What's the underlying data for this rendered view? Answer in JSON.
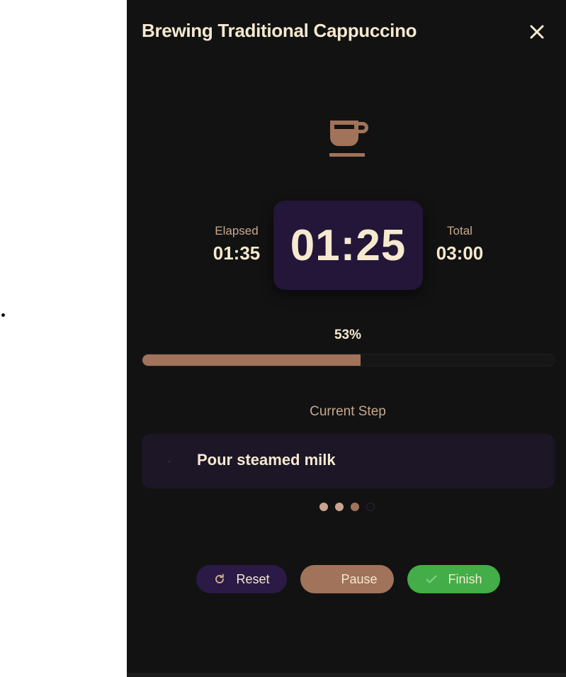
{
  "modal": {
    "title": "Brewing Traditional Cappuccino"
  },
  "icons": {
    "close": "close-icon",
    "cup": "coffee-cup-icon",
    "reset": "refresh-icon",
    "finish": "check-icon"
  },
  "stats": {
    "elapsed_label": "Elapsed",
    "elapsed_value": "01:35",
    "total_label": "Total",
    "total_value": "03:00"
  },
  "timer": {
    "remaining": "01:25"
  },
  "progress": {
    "label": "53%",
    "value": 0.53
  },
  "step": {
    "heading": "Current Step",
    "text": "Pour steamed milk",
    "indicators": [
      "done",
      "done",
      "active",
      "pending"
    ]
  },
  "buttons": {
    "reset_label": "Reset",
    "pause_label": "Pause",
    "finish_label": "Finish"
  },
  "colors": {
    "accent": "#a0735a",
    "cream": "#f5e9cf",
    "success": "#43ad47",
    "timer_bg": "#231638"
  }
}
